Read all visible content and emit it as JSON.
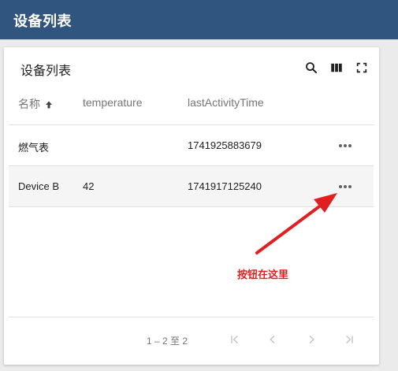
{
  "app": {
    "title": "设备列表"
  },
  "card": {
    "title": "设备列表",
    "tools": {
      "search_icon": "search-icon",
      "columns_icon": "view-column-icon",
      "fullscreen_icon": "fullscreen-icon"
    }
  },
  "table": {
    "columns": [
      "名称",
      "temperature",
      "lastActivityTime"
    ],
    "sort": {
      "column": "名称",
      "direction": "ascending"
    },
    "rows": [
      {
        "name": "燃气表",
        "temperature": "",
        "lastActivityTime": "1741925883679"
      },
      {
        "name": "Device B",
        "temperature": "42",
        "lastActivityTime": "1741917125240"
      }
    ],
    "row_action_icon": "more-horiz-icon"
  },
  "pagination": {
    "range_label": "1 – 2 至 2"
  },
  "annotation": {
    "text": "按钮在这里",
    "color": "#e02020"
  },
  "colors": {
    "header_bg": "#305680",
    "accent_red": "#e02020"
  }
}
